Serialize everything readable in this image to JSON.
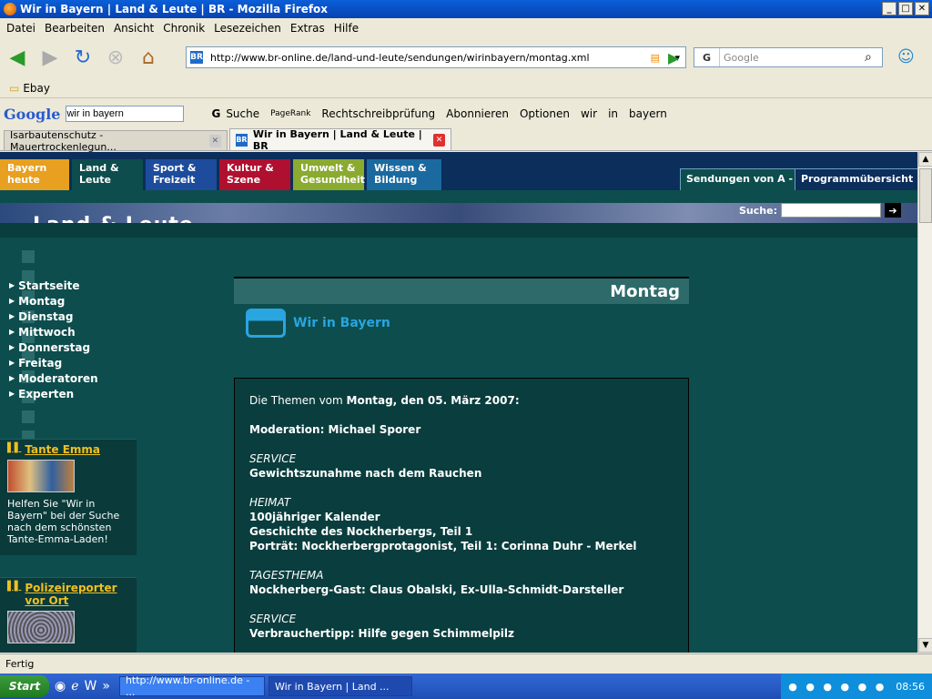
{
  "window": {
    "title": "Wir in Bayern | Land & Leute | BR - Mozilla Firefox"
  },
  "menu": [
    "Datei",
    "Bearbeiten",
    "Ansicht",
    "Chronik",
    "Lesezeichen",
    "Extras",
    "Hilfe"
  ],
  "nav": {
    "url": "http://www.br-online.de/land-und-leute/sendungen/wirinbayern/montag.xml",
    "search_placeholder": "Google"
  },
  "bookmarks": {
    "item": "Ebay"
  },
  "gbar": {
    "logo": "Google",
    "query": "wir in bayern",
    "suche": "Suche",
    "pagerank": "PageRank",
    "spell": "Rechtschreibprüfung",
    "subscribe": "Abonnieren",
    "options": "Optionen",
    "w1": "wir",
    "w2": "in",
    "w3": "bayern"
  },
  "tabs": [
    {
      "label": "Isarbautenschutz - Mauertrockenlegun..."
    },
    {
      "label": "Wir in Bayern | Land & Leute | BR"
    }
  ],
  "site": {
    "nav": [
      {
        "label": "Bayern heute",
        "color": "#e8a020"
      },
      {
        "label": "Land & Leute",
        "color": "#0d4d4d"
      },
      {
        "label": "Sport & Freizeit",
        "color": "#1d4c9c"
      },
      {
        "label": "Kultur & Szene",
        "color": "#b01030"
      },
      {
        "label": "Umwelt & Gesundheit",
        "color": "#8aaa30"
      },
      {
        "label": "Wissen & Bildung",
        "color": "#1a6aa0"
      }
    ],
    "right_tabs": [
      "Sendungen von A - Z",
      "Programmübersicht"
    ],
    "section_title": "Land & Leute",
    "search_label": "Suche:",
    "left_menu": [
      "Startseite",
      "Montag",
      "Dienstag",
      "Mittwoch",
      "Donnerstag",
      "Freitag",
      "Moderatoren",
      "Experten"
    ],
    "box1": {
      "title": "Tante Emma",
      "text": "Helfen Sie \"Wir in Bayern\" bei der Suche nach dem schönsten Tante-Emma-Laden!"
    },
    "box2": {
      "title": "Polizeireporter vor Ort"
    },
    "heading": "Montag",
    "logo_text": "Wir in Bayern",
    "content": {
      "intro_prefix": "Die Themen vom ",
      "intro_date": "Montag, den 05. März 2007:",
      "moderation": "Moderation: Michael Sporer",
      "sections": [
        {
          "cat": "SERVICE",
          "lines": [
            "Gewichtszunahme nach dem Rauchen"
          ]
        },
        {
          "cat": "HEIMAT",
          "lines": [
            "100jähriger Kalender",
            "Geschichte des Nockherbergs, Teil 1",
            "Porträt: Nockherbergprotagonist, Teil 1: Corinna Duhr - Merkel"
          ]
        },
        {
          "cat": "TAGESTHEMA",
          "lines": [
            "Nockherberg-Gast: Claus Obalski, Ex-Ulla-Schmidt-Darsteller"
          ]
        },
        {
          "cat": "SERVICE",
          "lines": [
            "Verbrauchertipp: Hilfe gegen Schimmelpilz"
          ]
        }
      ]
    }
  },
  "status": "Fertig",
  "taskbar": {
    "start": "Start",
    "buttons": [
      "http://www.br-online.de - ...",
      "Wir in Bayern | Land ..."
    ],
    "time": "08:56"
  }
}
